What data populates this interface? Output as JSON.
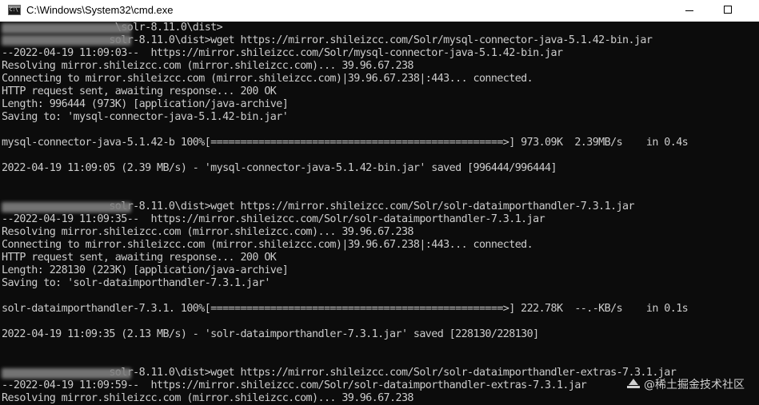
{
  "window": {
    "title": "C:\\Windows\\System32\\cmd.exe",
    "icon": "cmd-console-icon"
  },
  "console": {
    "lines": [
      "                   \\solr-8.11.0\\dist>",
      "                  solr-8.11.0\\dist>wget https://mirror.shileizcc.com/Solr/mysql-connector-java-5.1.42-bin.jar",
      "--2022-04-19 11:09:03--  https://mirror.shileizcc.com/Solr/mysql-connector-java-5.1.42-bin.jar",
      "Resolving mirror.shileizcc.com (mirror.shileizcc.com)... 39.96.67.238",
      "Connecting to mirror.shileizcc.com (mirror.shileizcc.com)|39.96.67.238|:443... connected.",
      "HTTP request sent, awaiting response... 200 OK",
      "Length: 996444 (973K) [application/java-archive]",
      "Saving to: 'mysql-connector-java-5.1.42-bin.jar'",
      "",
      "mysql-connector-java-5.1.42-b 100%[=================================================>] 973.09K  2.39MB/s    in 0.4s",
      "",
      "2022-04-19 11:09:05 (2.39 MB/s) - 'mysql-connector-java-5.1.42-bin.jar' saved [996444/996444]",
      "",
      "",
      "                  solr-8.11.0\\dist>wget https://mirror.shileizcc.com/Solr/solr-dataimporthandler-7.3.1.jar",
      "--2022-04-19 11:09:35--  https://mirror.shileizcc.com/Solr/solr-dataimporthandler-7.3.1.jar",
      "Resolving mirror.shileizcc.com (mirror.shileizcc.com)... 39.96.67.238",
      "Connecting to mirror.shileizcc.com (mirror.shileizcc.com)|39.96.67.238|:443... connected.",
      "HTTP request sent, awaiting response... 200 OK",
      "Length: 228130 (223K) [application/java-archive]",
      "Saving to: 'solr-dataimporthandler-7.3.1.jar'",
      "",
      "solr-dataimporthandler-7.3.1. 100%[=================================================>] 222.78K  --.-KB/s    in 0.1s",
      "",
      "2022-04-19 11:09:35 (2.13 MB/s) - 'solr-dataimporthandler-7.3.1.jar' saved [228130/228130]",
      "",
      "",
      "                  solr-8.11.0\\dist>wget https://mirror.shileizcc.com/Solr/solr-dataimporthandler-extras-7.3.1.jar",
      "--2022-04-19 11:09:59--  https://mirror.shileizcc.com/Solr/solr-dataimporthandler-extras-7.3.1.jar",
      "Resolving mirror.shileizcc.com (mirror.shileizcc.com)... 39.96.67.238"
    ]
  },
  "watermark": {
    "text": "@稀土掘金技术社区",
    "icon": "juejin-logo-icon"
  }
}
